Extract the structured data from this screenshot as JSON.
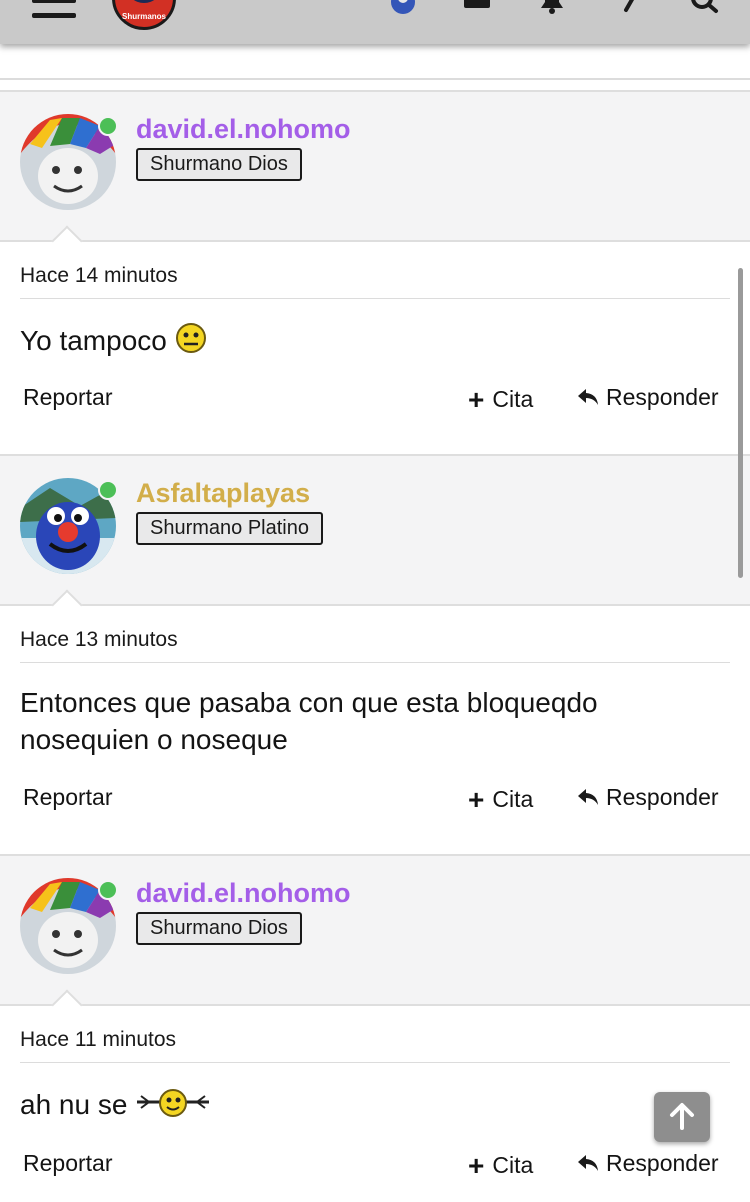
{
  "header": {
    "logo_text": "Shurmanos"
  },
  "posts": [
    {
      "username": "david.el.nohomo",
      "username_color": "#a45ee8",
      "rank": "Shurmano Dios",
      "time": "Hace 14 minutos",
      "lines": [
        "Yo tampoco"
      ],
      "emoji": "neutral-face-icon",
      "report": "Reportar",
      "quote": "Cita",
      "reply": "Responder"
    },
    {
      "username": "Asfaltaplayas",
      "username_color": "#d2ae4a",
      "rank": "Shurmano Platino",
      "time": "Hace 13 minutos",
      "lines": [
        "Entonces que pasaba con que esta bloqueqdo",
        "nosequien o noseque"
      ],
      "report": "Reportar",
      "quote": "Cita",
      "reply": "Responder"
    },
    {
      "username": "david.el.nohomo",
      "username_color": "#a45ee8",
      "rank": "Shurmano Dios",
      "time": "Hace 11 minutos",
      "lines": [
        "ah nu se"
      ],
      "emoji": "spinning-smiley-icon",
      "report": "Reportar",
      "quote": "Cita",
      "reply": "Responder"
    }
  ]
}
